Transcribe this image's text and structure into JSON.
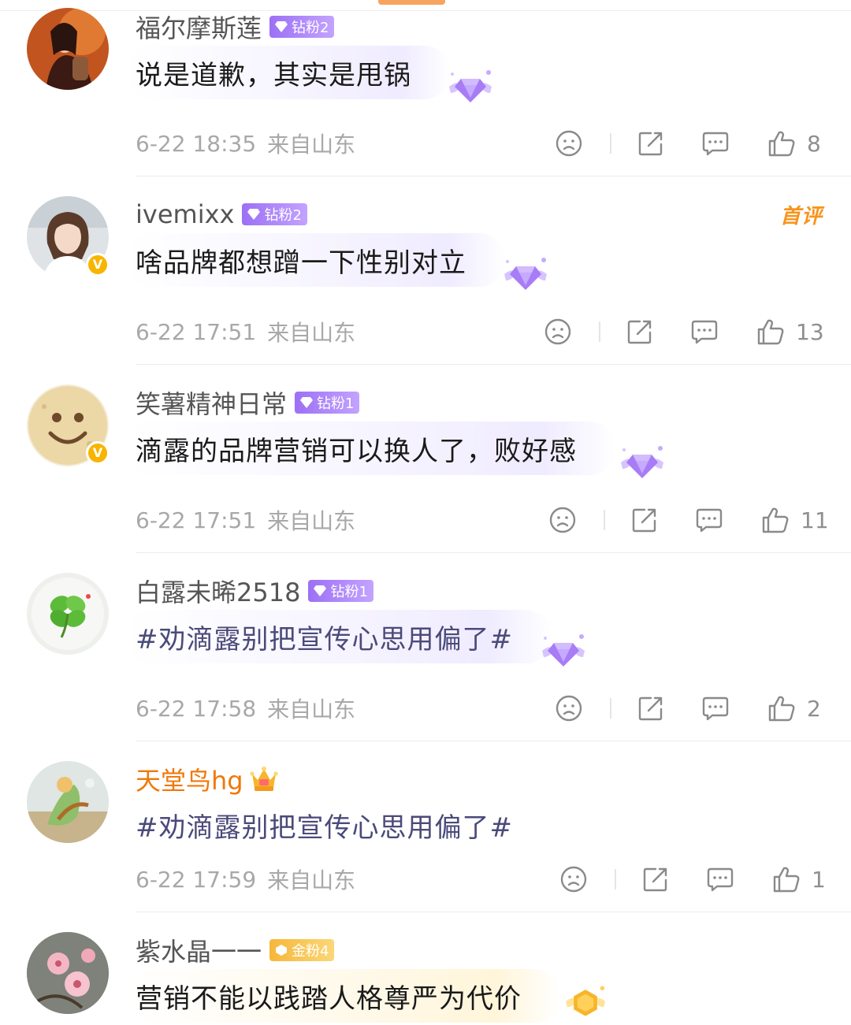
{
  "comments": [
    {
      "username": "福尔摩斯莲",
      "badge": "钻粉2",
      "badge_type": "diamond",
      "text": "说是道歉，其实是甩锅",
      "time": "6-22 18:35",
      "location": "来自山东",
      "likes": "8"
    },
    {
      "username": "ivemixx",
      "badge": "钻粉2",
      "badge_type": "diamond",
      "tag": "首评",
      "verified": true,
      "text": "啥品牌都想蹭一下性别对立",
      "time": "6-22 17:51",
      "location": "来自山东",
      "likes": "13"
    },
    {
      "username": "笑薯精神日常",
      "badge": "钻粉1",
      "badge_type": "diamond",
      "verified": true,
      "text": "滴露的品牌营销可以换人了，败好感",
      "time": "6-22 17:51",
      "location": "来自山东",
      "likes": "11"
    },
    {
      "username": "白露未晞2518",
      "badge": "钻粉1",
      "badge_type": "diamond",
      "text": "#劝滴露别把宣传心思用偏了#",
      "time": "6-22 17:58",
      "location": "来自山东",
      "likes": "2"
    },
    {
      "username": "天堂鸟hg",
      "badge_type": "crown",
      "text": "#劝滴露别把宣传心思用偏了#",
      "time": "6-22 17:59",
      "location": "来自山东",
      "likes": "1"
    },
    {
      "username": "紫水晶一一",
      "badge": "金粉4",
      "badge_type": "gold",
      "text": "营销不能以践踏人格尊严为代价"
    }
  ],
  "icons": {
    "dislike": "sad-face-icon",
    "share": "share-icon",
    "comment": "comment-bubble-icon",
    "like": "thumbs-up-icon",
    "verified": "verified-v-icon"
  },
  "colors": {
    "diamond_badge": "#9c70f5",
    "gold_badge": "#f6b73a",
    "orange_name": "#f0780a",
    "first_comment_tag": "#f7941d",
    "meta_text": "#a8a8a8"
  }
}
